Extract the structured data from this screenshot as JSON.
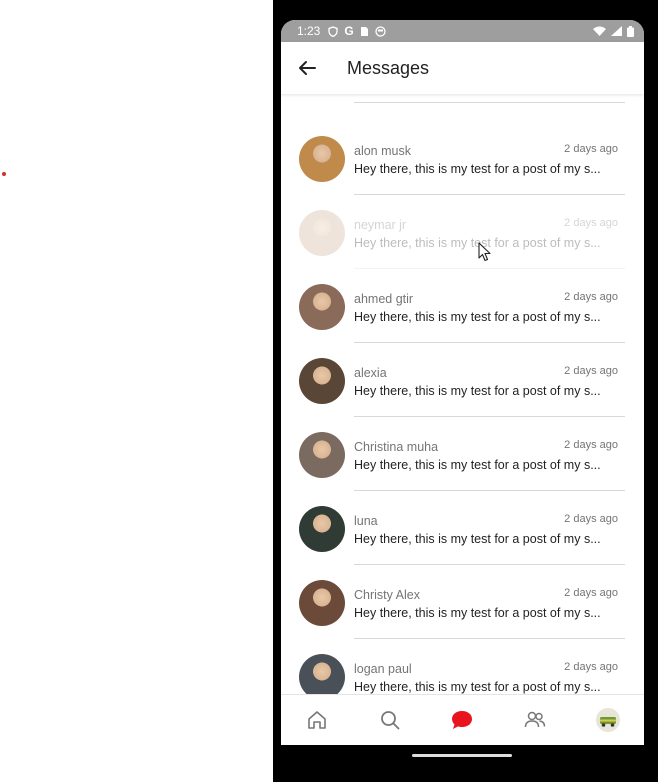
{
  "status_bar": {
    "time": "1:23"
  },
  "appbar": {
    "title": "Messages"
  },
  "conversations": [
    {
      "name": "alon musk",
      "time": "2 days ago",
      "preview": "Hey there, this is my test for a post of my s...",
      "avatar_color": "#c08a4a",
      "faded": false
    },
    {
      "name": "neymar jr",
      "time": "2 days ago",
      "preview": "Hey there, this is my test for a post of my s...",
      "avatar_color": "#c9a78e",
      "faded": true
    },
    {
      "name": "ahmed gtir",
      "time": "2 days ago",
      "preview": "Hey there, this is my test for a post of my s...",
      "avatar_color": "#8a6a58",
      "faded": false
    },
    {
      "name": "alexia",
      "time": "2 days ago",
      "preview": "Hey there, this is my test for a post of my s...",
      "avatar_color": "#5a4636",
      "faded": false
    },
    {
      "name": "Christina muha",
      "time": "2 days ago",
      "preview": "Hey there, this is my test for a post of my s...",
      "avatar_color": "#7a6a60",
      "faded": false
    },
    {
      "name": "luna",
      "time": "2 days ago",
      "preview": "Hey there, this is my test for a post of my s...",
      "avatar_color": "#2f3b34",
      "faded": false
    },
    {
      "name": "Christy Alex",
      "time": "2 days ago",
      "preview": "Hey there, this is my test for a post of my s...",
      "avatar_color": "#6b4a3a",
      "faded": false
    },
    {
      "name": "logan paul",
      "time": "2 days ago",
      "preview": "Hey there, this is my test for a post of my s...",
      "avatar_color": "#4a5058",
      "faded": false
    }
  ],
  "bottom_nav": [
    {
      "name": "nav-home",
      "icon": "home-icon",
      "active": false
    },
    {
      "name": "nav-search",
      "icon": "search-icon",
      "active": false
    },
    {
      "name": "nav-messages",
      "icon": "chat-bubble-icon",
      "active": true
    },
    {
      "name": "nav-friends",
      "icon": "people-icon",
      "active": false
    },
    {
      "name": "nav-profile",
      "icon": "avatar-icon",
      "active": false
    }
  ],
  "colors": {
    "accent": "#e8141e",
    "status_bar": "#9e9e9e",
    "muted_text": "#757575",
    "divider": "#d8d8d8"
  }
}
